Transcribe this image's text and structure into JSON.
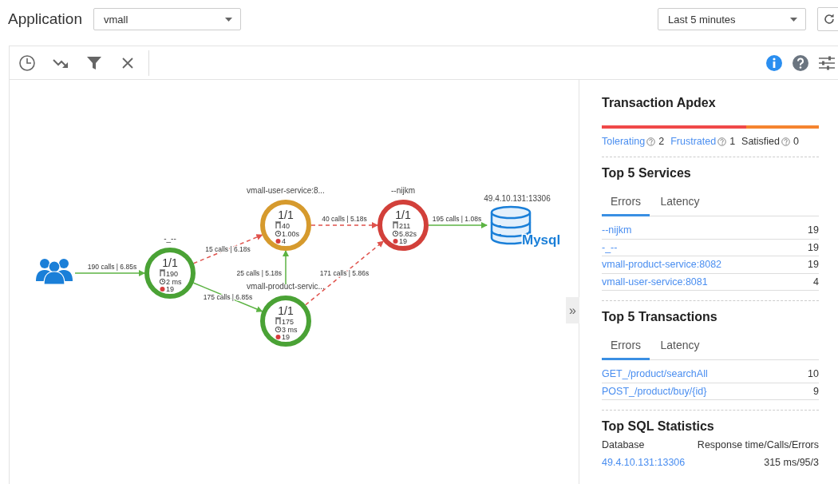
{
  "header": {
    "label": "Application",
    "app_select": {
      "value": "vmall"
    },
    "time_select": {
      "value": "Last 5 minutes"
    }
  },
  "graph": {
    "nodes": [
      {
        "kind": "users"
      },
      {
        "kind": "service",
        "title": "-_--",
        "ratio": "1/1",
        "calls": "190",
        "time": "2 ms",
        "errors": "19",
        "color": "#4aa235"
      },
      {
        "kind": "service",
        "title": "vmall-user-service:8...",
        "ratio": "1/1",
        "calls": "40",
        "time": "1.00s",
        "errors": "4",
        "color": "#d69a2d"
      },
      {
        "kind": "service",
        "title": "vmall-product-servic...",
        "ratio": "1/1",
        "calls": "175",
        "time": "3 ms",
        "errors": "19",
        "color": "#4aa235"
      },
      {
        "kind": "service",
        "title": "--nijkm",
        "ratio": "1/1",
        "calls": "211",
        "time": "5.82s",
        "errors": "19",
        "color": "#d2403a"
      },
      {
        "kind": "database",
        "title": "49.4.10.131:13306",
        "label": "Mysql"
      }
    ],
    "edges": [
      {
        "kind": "normal",
        "label": "190 calls | 6.85s"
      },
      {
        "kind": "error",
        "label": "15 calls | 6.18s"
      },
      {
        "kind": "normal",
        "label": "175 calls | 6.85s"
      },
      {
        "kind": "normal",
        "label": "25 calls | 5.18s"
      },
      {
        "kind": "error",
        "label": "40 calls | 5.18s"
      },
      {
        "kind": "error",
        "label": "171 calls | 5.86s"
      },
      {
        "kind": "normal",
        "label": "195 calls | 1.08s"
      }
    ],
    "collapse": "»"
  },
  "apdex": {
    "title": "Transaction Apdex",
    "bar": [
      {
        "level": 0.667,
        "color": "#f04848"
      },
      {
        "level": 0.333,
        "color": "#f5842f"
      }
    ],
    "legend": [
      {
        "name": "Tolerating",
        "count": "2",
        "kind": "link"
      },
      {
        "name": "Frustrated",
        "count": "1",
        "kind": "link"
      },
      {
        "name": "Satisfied",
        "count": "0",
        "kind": "plain"
      }
    ]
  },
  "top_services": {
    "title": "Top 5 Services",
    "tabs": [
      {
        "label": "Errors",
        "selected": true
      },
      {
        "label": "Latency",
        "selected": false
      }
    ],
    "rows": [
      {
        "name": "--nijkm",
        "value": "19"
      },
      {
        "name": "-_--",
        "value": "19"
      },
      {
        "name": "vmall-product-service:8082",
        "value": "19"
      },
      {
        "name": "vmall-user-service:8081",
        "value": "4"
      }
    ]
  },
  "top_transactions": {
    "title": "Top 5 Transactions",
    "tabs": [
      {
        "label": "Errors",
        "selected": true
      },
      {
        "label": "Latency",
        "selected": false
      }
    ],
    "rows": [
      {
        "name": "GET_/product/searchAll",
        "value": "10"
      },
      {
        "name": "POST_/product/buy/{id}",
        "value": "9"
      }
    ]
  },
  "sql": {
    "title": "Top SQL Statistics",
    "columns": [
      "Database",
      "Response time/Calls/Errors"
    ],
    "rows": [
      {
        "database": "49.4.10.131:13306",
        "stats": "315 ms/95/3"
      }
    ]
  }
}
